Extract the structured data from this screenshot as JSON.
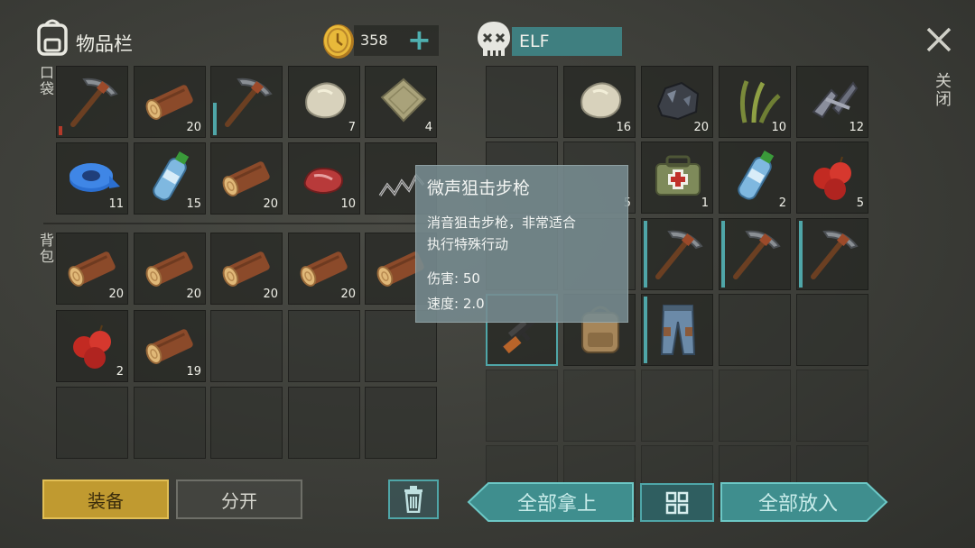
{
  "header": {
    "inventory_title": "物品栏",
    "coin_count": "358",
    "add_symbol": "+",
    "loot_title": "ELF",
    "close_label": "关闭"
  },
  "section_labels": {
    "pocket": "口袋",
    "backpack": "背包"
  },
  "pocket": [
    {
      "item": "pickaxe",
      "count": "",
      "durability": "low"
    },
    {
      "item": "log",
      "count": "20"
    },
    {
      "item": "pickaxe",
      "count": "",
      "durability": "mid"
    },
    {
      "item": "stone",
      "count": "7"
    },
    {
      "item": "cloth",
      "count": "4"
    },
    {
      "item": "tape",
      "count": "11"
    },
    {
      "item": "water-bottle",
      "count": "15"
    },
    {
      "item": "log",
      "count": "20"
    },
    {
      "item": "raw-meat",
      "count": "10"
    },
    {
      "item": "spring",
      "count": ""
    }
  ],
  "backpack": [
    {
      "item": "log",
      "count": "20"
    },
    {
      "item": "log",
      "count": "20"
    },
    {
      "item": "log",
      "count": "20"
    },
    {
      "item": "log",
      "count": "20"
    },
    {
      "item": "log",
      "count": ""
    },
    {
      "item": "apples",
      "count": "2"
    },
    {
      "item": "log",
      "count": "19"
    }
  ],
  "loot": [
    {
      "item": "",
      "count": ""
    },
    {
      "item": "stone",
      "count": "16"
    },
    {
      "item": "iron-ore",
      "count": "20"
    },
    {
      "item": "plant-fiber",
      "count": "10"
    },
    {
      "item": "metal-scrap",
      "count": "12"
    },
    {
      "item": "",
      "count": ""
    },
    {
      "item": "",
      "count": "5"
    },
    {
      "item": "first-aid-bag",
      "count": "1"
    },
    {
      "item": "water-bottle",
      "count": "2"
    },
    {
      "item": "apples",
      "count": "5"
    },
    {
      "item": "",
      "count": ""
    },
    {
      "item": "",
      "count": ""
    },
    {
      "item": "pickaxe",
      "count": ""
    },
    {
      "item": "pickaxe",
      "count": ""
    },
    {
      "item": "pickaxe",
      "count": ""
    },
    {
      "item": "sniper-rifle",
      "count": ""
    },
    {
      "item": "backpack",
      "count": ""
    },
    {
      "item": "pants",
      "count": ""
    }
  ],
  "tooltip": {
    "title": "微声狙击步枪",
    "desc_line1": "消音狙击步枪，非常适合",
    "desc_line2": "执行特殊行动",
    "damage": "伤害: 50",
    "speed": "速度: 2.0"
  },
  "bottom": {
    "equip_label": "装备",
    "split_label": "分开",
    "take_all_label": "全部拿上",
    "put_all_label": "全部放入"
  },
  "colors": {
    "accent_teal": "#4fa6a8",
    "equip_gold": "#c8a030",
    "loot_name_bg": "#3f7f80"
  }
}
